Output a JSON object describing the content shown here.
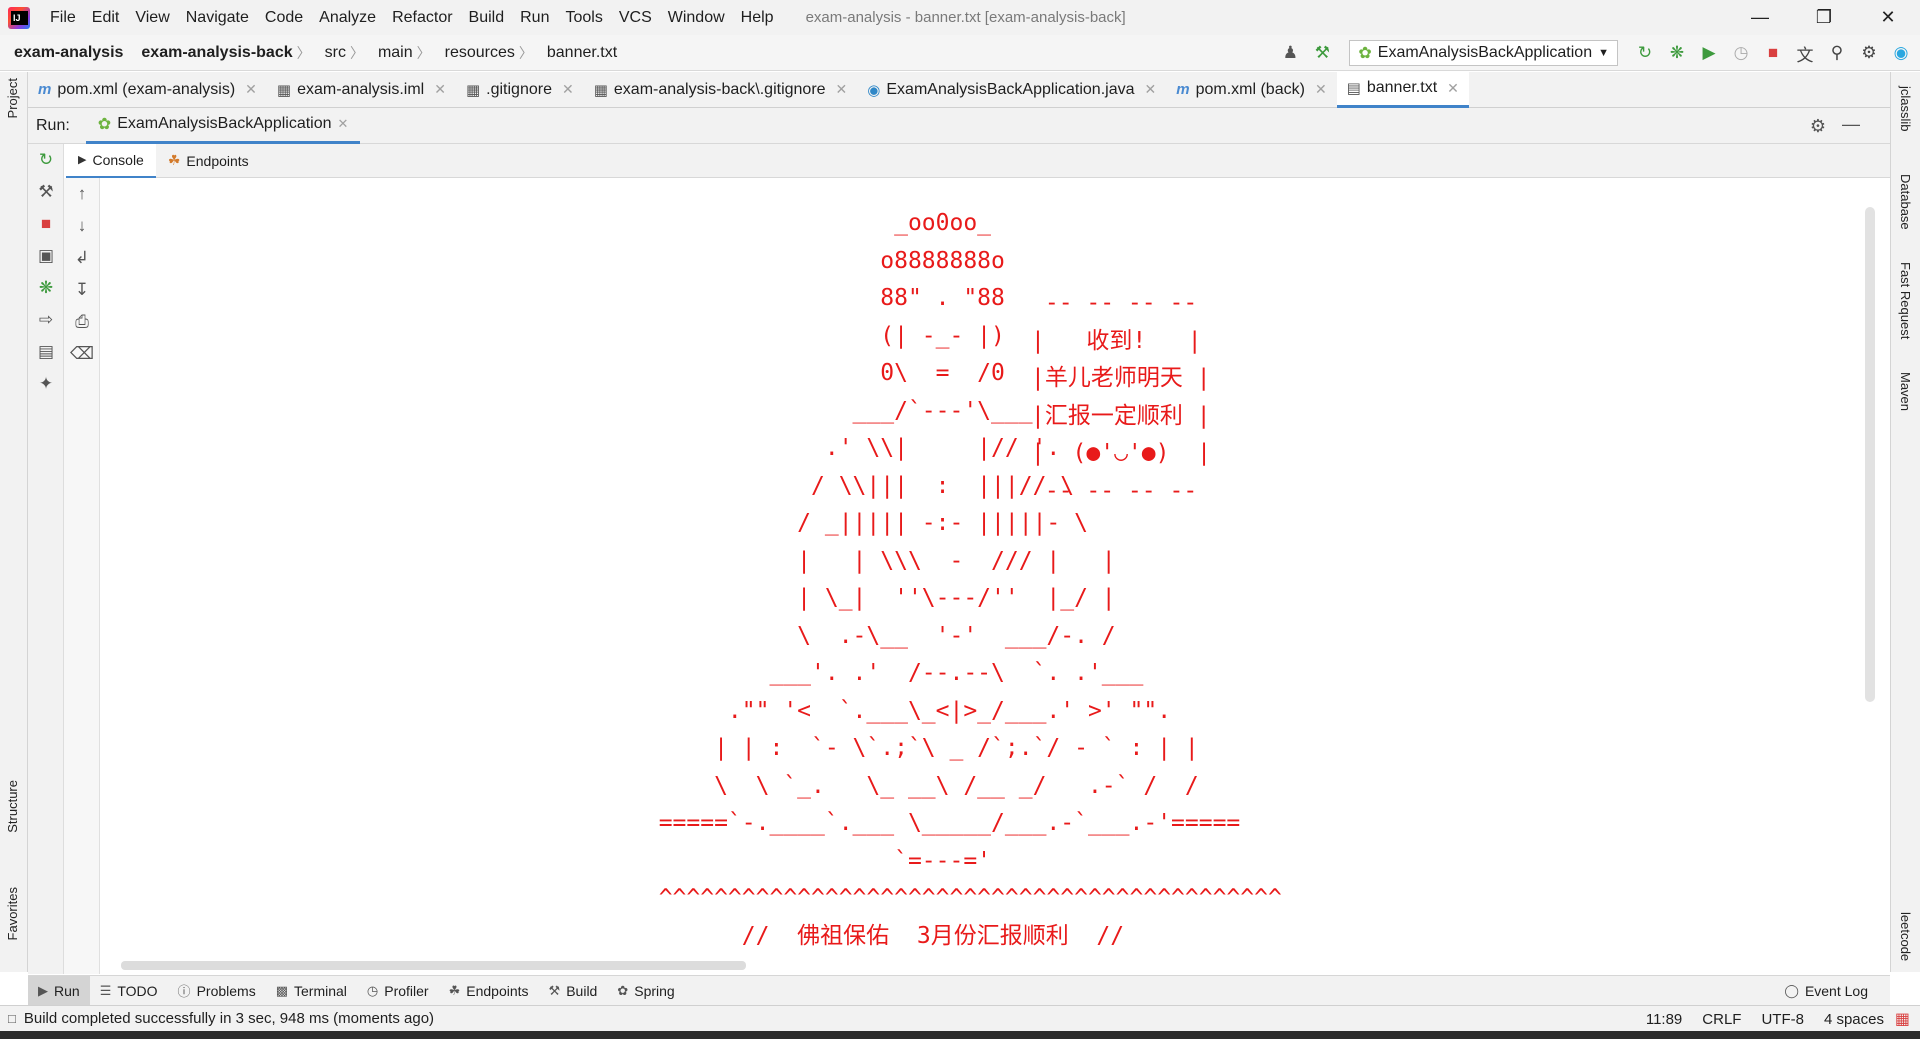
{
  "menu": [
    "File",
    "Edit",
    "View",
    "Navigate",
    "Code",
    "Analyze",
    "Refactor",
    "Build",
    "Run",
    "Tools",
    "VCS",
    "Window",
    "Help"
  ],
  "window_title": "exam-analysis - banner.txt [exam-analysis-back]",
  "breadcrumbs": [
    "exam-analysis",
    "exam-analysis-back",
    "src",
    "main",
    "resources",
    "banner.txt"
  ],
  "run_config": "ExamAnalysisBackApplication",
  "editor_tabs": [
    {
      "label": "pom.xml (exam-analysis)",
      "icon": "m"
    },
    {
      "label": "exam-analysis.iml",
      "icon": "iml"
    },
    {
      "label": ".gitignore",
      "icon": "git"
    },
    {
      "label": "exam-analysis-back\\.gitignore",
      "icon": "git"
    },
    {
      "label": "ExamAnalysisBackApplication.java",
      "icon": "spring"
    },
    {
      "label": "pom.xml (back)",
      "icon": "m"
    },
    {
      "label": "banner.txt",
      "icon": "txt"
    }
  ],
  "run_panel": {
    "label": "Run:",
    "tab": "ExamAnalysisBackApplication",
    "subtabs": [
      "Console",
      "Endpoints"
    ]
  },
  "left_stripe": [
    "Project",
    "Structure",
    "Favorites"
  ],
  "right_stripe": [
    "jclasslib",
    "Database",
    "Fast Request",
    "Maven",
    "leetcode"
  ],
  "banner_text": "                   _oo0oo_\n                  o8888888o\n                  88\" . \"88\n                  (| -_- |)\n                  0\\  =  /0\n                ___/`---'\\___\n              .' \\\\|     |// '.\n             / \\\\|||  :  |||// \\\n            / _||||| -:- |||||- \\\n            |   | \\\\\\  -  /// |   |\n            | \\_|  ''\\---/''  |_/ |\n            \\  .-\\__  '-'  ___/-. /\n          ___'. .'  /--.--\\  `. .'___\n       .\"\" '<  `.___\\_<|>_/___.' >' \"\".\n      | | :  `- \\`.;`\\ _ /`;.`/ - ` : | |\n      \\  \\ `_.   \\_ __\\ /__ _/   .-` /  /\n  =====`-.____`.___ \\_____/___.-`___.-'=====\n                   `=---='\n  ^^^^^^^^^^^^^^^^^^^^^^^^^^^^^^^^^^^^^^^^^^^^^\n        //  佛祖保佑  3月份汇报顺利  //",
  "bubble_text": " -- -- -- --\n|   收到!   |\n|羊儿老师明天 |\n|汇报一定顺利 |\n|  (●'◡'●)  |\n -- -- -- --",
  "bottom_tools": [
    "Run",
    "TODO",
    "Problems",
    "Terminal",
    "Profiler",
    "Endpoints",
    "Build",
    "Spring"
  ],
  "event_log": "Event Log",
  "status": {
    "message": "Build completed successfully in 3 sec, 948 ms (moments ago)",
    "position": "11:89",
    "line_sep": "CRLF",
    "encoding": "UTF-8",
    "indent": "4 spaces"
  },
  "colors": {
    "banner": "#e81a1a",
    "accent": "#4083c9"
  }
}
